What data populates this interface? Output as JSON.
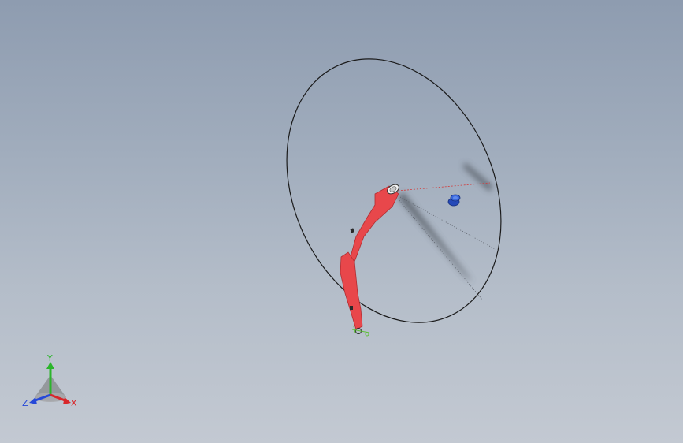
{
  "viewport": {
    "background_top": "#8e9cb0",
    "background_bottom": "#c3c9d2"
  },
  "model": {
    "part_color": "#e8474b",
    "part_outline": "#b02d31",
    "sketch_color": "#1a1a1a",
    "construction_color": "#d23c3c",
    "knob_color": "#2f5ec9"
  },
  "triad": {
    "x_label": "X",
    "y_label": "Y",
    "z_label": "Z",
    "x_color": "#d8262a",
    "y_color": "#2bb52b",
    "z_color": "#2648d8"
  }
}
